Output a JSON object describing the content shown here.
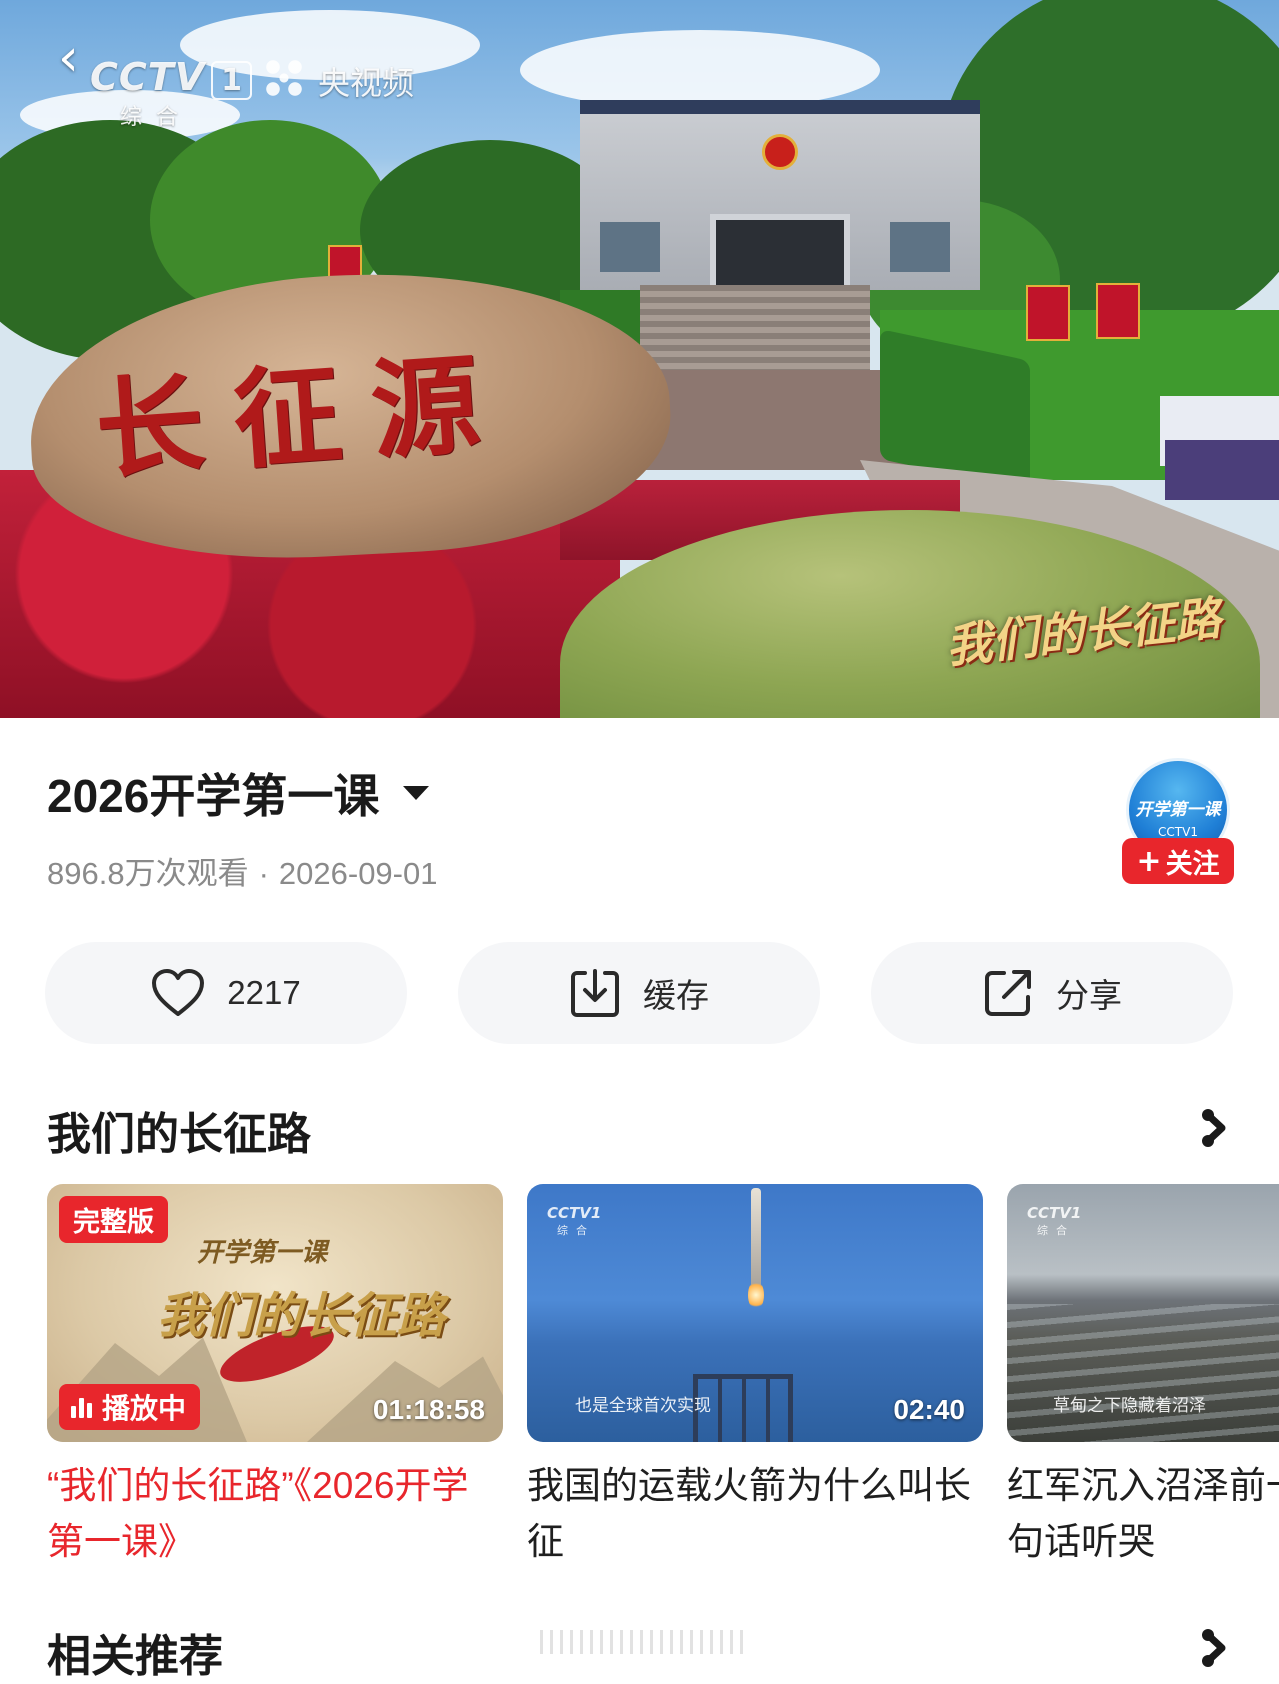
{
  "player": {
    "channel_name": "CCTV",
    "channel_number": "1",
    "channel_sub": "综合",
    "platform": "央视频",
    "rock_inscription": "长征源",
    "overlay_title": "我们的长征路"
  },
  "video": {
    "title": "2026开学第一课",
    "views": "896.8万次观看",
    "date": "2026-09-01"
  },
  "channel": {
    "avatar_text": "开学第一课",
    "avatar_sub": "CCTV1",
    "follow_label": "关注"
  },
  "actions": {
    "like_count": "2217",
    "cache_label": "缓存",
    "share_label": "分享"
  },
  "playlist": {
    "title": "我们的长征路",
    "items": [
      {
        "badge": "完整版",
        "playing_label": "播放中",
        "duration": "01:18:58",
        "thumb_title_big": "我们的长征路",
        "thumb_title_small": "开学第一课",
        "title": "“我们的长征路”《2026开学第一课》"
      },
      {
        "logo": "CCTV1",
        "logo_sub": "综合",
        "caption": "也是全球首次实现",
        "duration": "02:40",
        "title": "我国的运载火箭为什么叫长征"
      },
      {
        "logo": "CCTV1",
        "logo_sub": "综合",
        "caption": "草甸之下隐藏着沼泽",
        "title": "红军沉入沼泽前一句话听哭"
      }
    ]
  },
  "related": {
    "title": "相关推荐"
  },
  "colors": {
    "accent_red": "#e8262c",
    "button_bg": "#f5f6f8",
    "meta_gray": "#8a8a8a"
  }
}
